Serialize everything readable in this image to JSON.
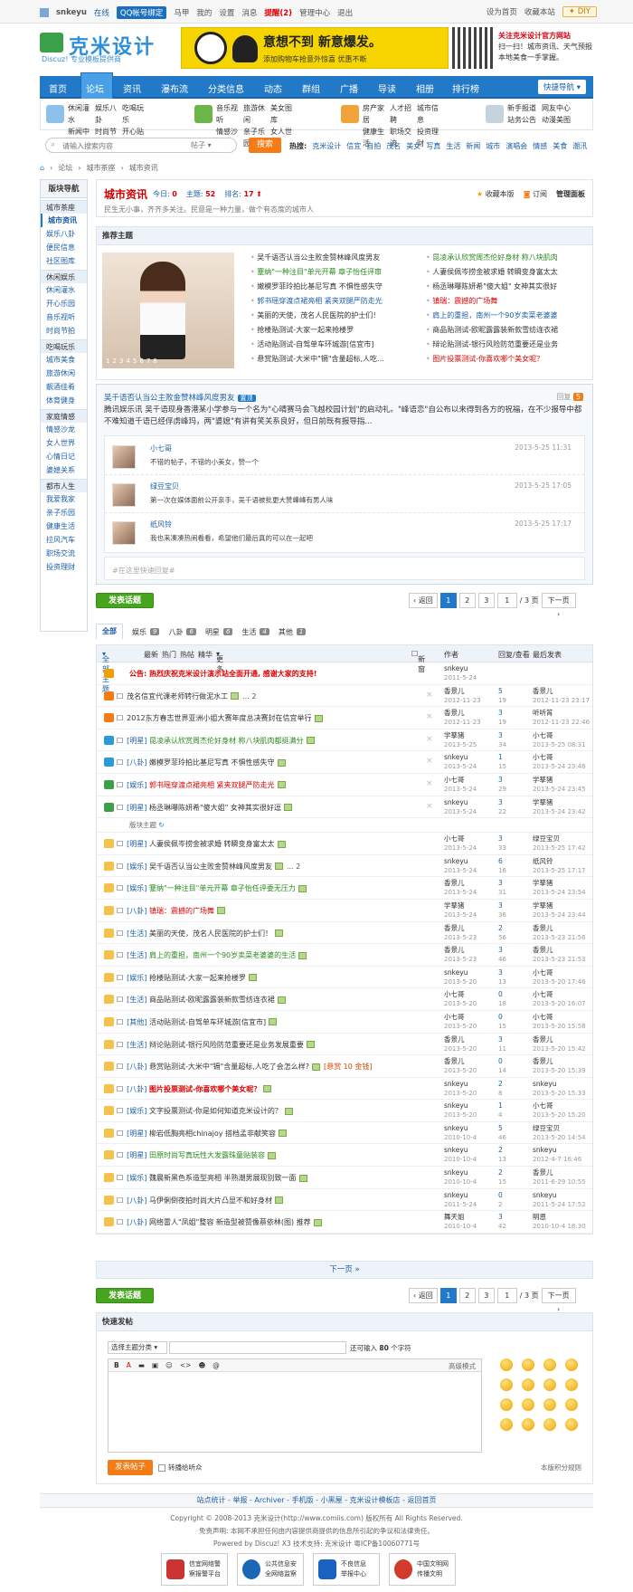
{
  "topbar": {
    "user": "snkeyu",
    "status": "在线",
    "qq": "QQ帐号绑定",
    "horse": "马甲",
    "my": "我的",
    "settings": "设置",
    "msg": "消息",
    "remind": "提醒(2)",
    "admin": "管理中心",
    "logout": "退出",
    "home": "设为首页",
    "fav": "收藏本站",
    "diy": "DIY"
  },
  "logo": {
    "name": "克米设计",
    "sub": "Discuz! 专业模板提供商"
  },
  "banner": {
    "line1": "意想不到",
    "line2": "新意爆发。",
    "line3": "添加购物车抢意外惊喜 优惠不断"
  },
  "qr": {
    "title": "关注克米设计官方网站",
    "l2": "扫一扫！城市资讯、天气预报",
    "l3": "本地美食一手掌握。"
  },
  "nav": {
    "items": [
      "首页",
      "论坛",
      "资讯",
      "瀑布流",
      "分类信息",
      "动态",
      "群组",
      "广播",
      "导读",
      "相册",
      "排行榜"
    ],
    "quick": "快捷导航"
  },
  "subnav": [
    [
      "休闲灌水",
      "娱乐八卦",
      "吃喝玩乐",
      "新闻中心",
      "时尚节拍",
      "开心贴图"
    ],
    [
      "音乐视听",
      "旅游休闲",
      "美女图库",
      "情感沙龙",
      "亲子乐园",
      "女人世界"
    ],
    [
      "房产家居",
      "人才招聘",
      "城市信息",
      "健康生活",
      "职场交流",
      "投资理财"
    ],
    [
      "新手报道",
      "网友中心",
      "站务公告",
      "动漫美图"
    ]
  ],
  "search": {
    "placeholder": "请输入搜索内容",
    "type": "帖子",
    "btn": "搜索",
    "hot_label": "热搜:",
    "hot": [
      "克米设计",
      "信宜",
      "自拍",
      "茂名",
      "美女",
      "写真",
      "生活",
      "新闻",
      "城市",
      "演唱会",
      "情感",
      "美食",
      "潮汛"
    ]
  },
  "crumb": [
    "论坛",
    "城市茶座",
    "城市资讯"
  ],
  "side": {
    "title": "版块导航",
    "groups": [
      {
        "name": "城市茶座",
        "items": [
          "城市资讯",
          "娱乐八卦",
          "便民信息",
          "社区图库"
        ]
      },
      {
        "name": "休闲娱乐",
        "items": [
          "休闲灌水",
          "开心乐园",
          "音乐视听",
          "时尚节拍"
        ]
      },
      {
        "name": "吃喝玩乐",
        "items": [
          "城市美食",
          "旅游休闲",
          "靓酒佳肴",
          "体育健身"
        ]
      },
      {
        "name": "家庭情感",
        "items": [
          "情感沙龙",
          "女人世界",
          "心情日记",
          "婆媳关系"
        ]
      },
      {
        "name": "都市人生",
        "items": [
          "我爱我家",
          "亲子乐园",
          "健康生活",
          "拉风汽车",
          "职场交流",
          "投资理财"
        ]
      }
    ]
  },
  "forum": {
    "title": "城市资讯",
    "today_label": "今日:",
    "today": "0",
    "topics_label": "主题:",
    "topics": "52",
    "rank_label": "排名:",
    "rank": "17",
    "desc": "民生无小事，齐齐多关注。民意是一种力量，做个有态度的城市人",
    "fav": "收藏本版",
    "sub": "订阅",
    "mgr": "管理面板"
  },
  "rec": {
    "title": "推荐主题",
    "dots": [
      "1",
      "2",
      "3",
      "4",
      "5",
      "6",
      "7",
      "8"
    ],
    "col1": [
      "吴千语否认当公主败金赞林峰风度男友",
      "蹇纳\"一种注目\"单元开幕 章子怡任评审",
      "嫩模罗菲玲拍比基尼写真 不惧性感失守",
      "郭书瑶穿渡点裙亮相 紧夹双腿严防走光",
      "美丽的天使，茂名人民医院的护士们！",
      "抢楼贴测试-大家一起来抢楼罗",
      "活动贴测试-自驾单车环城游[信宜市]",
      "悬赏贴测试-大米中\"镉\"含量超标,人吃..."
    ],
    "col2": [
      "昆凌承认欣赏周杰伦好身材 称八块肌肉",
      "人妻侯佩岑捞金被求婚 转瞬变身富太太",
      "杨丞琳曝陈妍希\"傻大姐\" 女神其实很好",
      "镇瑞：震撼的广场舞",
      "肩上的重担，南州一个90岁卖菜老婆婆",
      "商品贴测试-欧昵露露装新款雪纺连衣裙",
      "辩论贴测试-银行风险防范重要还是业务",
      "图片投票测试-你喜欢哪个美女呢？"
    ]
  },
  "hot": {
    "title": "吴千语否认当公主败金赞林峰风度男友",
    "tag": "置顶",
    "reply_label": "回复",
    "reply": "5",
    "summary": "腾讯娱乐讯 吴千语现身香港某小学参与一个名为\"心晴赛马会飞越校园计划\"的启动礼。\"峰语恋\"自公布以来得到各方的祝福，在不少报导中都不难知道千语已经俘虏峰玛，两\"婆媳\"有讲有笑关系良好，但日前既有报导指...",
    "comments": [
      {
        "name": "小七哥",
        "text": "不错的帖子，不错的小美女，赞一个",
        "time": "2013-5-25 11:31"
      },
      {
        "name": "绿豆宝贝",
        "text": "第一次在媒体面前公开亲手，吴千语被批更大赞峰峰有男人味",
        "time": "2013-5-25 17:05"
      },
      {
        "name": "纸风铃",
        "text": "我也来凑凑热闹看看，希望他们最后真的可以在一起吧",
        "time": "2013-5-25 17:17"
      }
    ],
    "quick_reply": "#在这里快速回复#"
  },
  "post_btn": "发表话题",
  "pager": {
    "prev": "返回",
    "pages": [
      "1",
      "2",
      "3"
    ],
    "input": "1",
    "total": "/ 3 页",
    "next": "下一页"
  },
  "tabs": [
    {
      "label": "全部",
      "count": ""
    },
    {
      "label": "娱乐",
      "count": "9"
    },
    {
      "label": "八卦",
      "count": "6"
    },
    {
      "label": "明星",
      "count": "6"
    },
    {
      "label": "生活",
      "count": "4"
    },
    {
      "label": "其他",
      "count": "1"
    }
  ],
  "thead": {
    "all": "全部主题",
    "links": [
      "最新",
      "热门",
      "热帖",
      "精华",
      "更多"
    ],
    "newwin": "新窗",
    "author": "作者",
    "reply": "回复/查看",
    "last": "最后发表"
  },
  "sep_label": "版块主题",
  "rows_top": [
    {
      "t": "公告: 热烈庆祝克米设计演示站全面开通, 感谢大家的支持!",
      "ty": "",
      "cls": "hl",
      "a": "snkeyu",
      "d": "2011-5-24",
      "r": "",
      "v": "",
      "l": "",
      "ld": "",
      "icon": "ann"
    },
    {
      "t": "茂名信宜代课老师转行做泥水工",
      "ty": "",
      "cls": "",
      "a": "香景儿",
      "d": "2012-11-23",
      "r": "5",
      "v": "19",
      "l": "香景儿",
      "ld": "2012-11-23 23:17",
      "icon": "top3",
      "extra": "... 2"
    },
    {
      "t": "2012东方春志世界亚洲小姐大赛年度总决赛封在信宜举行",
      "ty": "",
      "cls": "",
      "a": "香景儿",
      "d": "2012-11-23",
      "r": "3",
      "v": "19",
      "l": "听听筲",
      "ld": "2012-11-23 22:46",
      "icon": "top3"
    },
    {
      "t": "昆凌承认欣赏周杰伦好身材 称八块肌肉都挺满分",
      "ty": "[明星]",
      "cls": "gn",
      "a": "学孳猪",
      "d": "2013-5-25",
      "r": "3",
      "v": "34",
      "l": "小七哥",
      "ld": "2013-5-25 08:31",
      "icon": "top2"
    },
    {
      "t": "嫩模罗菲玲拍比基尼写真 不惧性感失守",
      "ty": "[八卦]",
      "cls": "",
      "a": "snkeyu",
      "d": "2013-5-24",
      "r": "1",
      "v": "15",
      "l": "小七哥",
      "ld": "2013-5-24 23:46",
      "icon": "top2"
    },
    {
      "t": "郭书瑶穿渡点裙亮相 紧夹双腿严防走光",
      "ty": "[娱乐]",
      "cls": "hl2",
      "a": "小七哥",
      "d": "2013-5-24",
      "r": "3",
      "v": "29",
      "l": "学孳猪",
      "ld": "2013-5-24 23:45",
      "icon": "top1"
    },
    {
      "t": "杨丞琳曝陈妍希\"傻大姐\" 女神其实很好逗",
      "ty": "[明星]",
      "cls": "",
      "a": "snkeyu",
      "d": "2013-5-24",
      "r": "3",
      "v": "22",
      "l": "学孳猪",
      "ld": "2013-5-24 23:42",
      "icon": "top1"
    }
  ],
  "rows": [
    {
      "t": "人妻侯佩岑捞金被求婚 转瞬变身富太太",
      "ty": "[明星]",
      "cls": "",
      "a": "小七哥",
      "d": "2013-5-24",
      "r": "3",
      "v": "33",
      "l": "绿豆宝贝",
      "ld": "2013-5-25 17:42"
    },
    {
      "t": "吴千语否认当公主败金赞林峰风度男友",
      "ty": "[娱乐]",
      "cls": "",
      "a": "snkeyu",
      "d": "2013-5-24",
      "r": "6",
      "v": "16",
      "l": "纸风铃",
      "ld": "2013-5-25 17:17",
      "extra": "... 2"
    },
    {
      "t": "蹇纳\"一种注目\"单元开幕 章子怡任评委无压力",
      "ty": "[娱乐]",
      "cls": "gn",
      "a": "香景儿",
      "d": "2013-5-24",
      "r": "3",
      "v": "31",
      "l": "学孳猪",
      "ld": "2013-5-24 23:54"
    },
    {
      "t": "镇瑞：震撼的广场舞",
      "ty": "[八卦]",
      "cls": "hl2",
      "a": "学孳猪",
      "d": "2013-5-24",
      "r": "3",
      "v": "36",
      "l": "学孳猪",
      "ld": "2013-5-24 23:44"
    },
    {
      "t": "美丽的天使，茂名人民医院的护士们！",
      "ty": "[生活]",
      "cls": "",
      "a": "香景儿",
      "d": "2013-5-23",
      "r": "2",
      "v": "56",
      "l": "香景儿",
      "ld": "2013-5-23 21:56"
    },
    {
      "t": "肩上的重担，南州一个90岁卖菜老婆婆的生活",
      "ty": "[生活]",
      "cls": "gn",
      "a": "香景儿",
      "d": "2013-5-23",
      "r": "3",
      "v": "46",
      "l": "香景儿",
      "ld": "2013-5-23 21:53"
    },
    {
      "t": "抢楼贴测试-大家一起来抢楼罗",
      "ty": "[娱乐]",
      "cls": "",
      "a": "snkeyu",
      "d": "2013-5-20",
      "r": "3",
      "v": "13",
      "l": "小七哥",
      "ld": "2013-5-20 17:46"
    },
    {
      "t": "商品贴测试-欧昵露露装新款雪纺连衣裙",
      "ty": "[生活]",
      "cls": "",
      "a": "小七哥",
      "d": "2013-5-20",
      "r": "0",
      "v": "18",
      "l": "小七哥",
      "ld": "2013-5-20 16:07"
    },
    {
      "t": "活动贴测试-自驾单车环城游[信宜市]",
      "ty": "[其他]",
      "cls": "",
      "a": "小七哥",
      "d": "2013-5-20",
      "r": "0",
      "v": "15",
      "l": "小七哥",
      "ld": "2013-5-20 15:58"
    },
    {
      "t": "辩论贴测试-银行风险防范重要还是业务发展重要",
      "ty": "[生活]",
      "cls": "",
      "a": "香景儿",
      "d": "2013-5-20",
      "r": "3",
      "v": "11",
      "l": "香景儿",
      "ld": "2013-5-20 15:42"
    },
    {
      "t": "悬赏贴测试-大米中\"镉\"含量超标,人吃了会怎么样?",
      "ty": "[八卦]",
      "cls": "",
      "a": "香景儿",
      "d": "2013-5-20",
      "r": "0",
      "v": "14",
      "l": "香景儿",
      "ld": "2013-5-20 15:39",
      "reward": "[悬赏 10 金钱]"
    },
    {
      "t": "图片投票测试-你喜欢哪个美女呢？",
      "ty": "[八卦]",
      "cls": "hl",
      "a": "snkeyu",
      "d": "2013-5-20",
      "r": "2",
      "v": "8",
      "l": "snkeyu",
      "ld": "2013-5-20 15:33"
    },
    {
      "t": "文字投票测试-你是如何知道克米设计的？",
      "ty": "[娱乐]",
      "cls": "",
      "a": "snkeyu",
      "d": "2013-5-20",
      "r": "1",
      "v": "4",
      "l": "小七哥",
      "ld": "2013-5-20 15:20"
    },
    {
      "t": "柳岩低胸亮相chinajoy 搭档孟非献笑容",
      "ty": "[明星]",
      "cls": "",
      "a": "snkeyu",
      "d": "2010-10-4",
      "r": "5",
      "v": "46",
      "l": "绿豆宝贝",
      "ld": "2013-5-20 14:54"
    },
    {
      "t": "田原时尚写真玩性大发露珠童贴装容",
      "ty": "[明星]",
      "cls": "gn",
      "a": "snkeyu",
      "d": "2010-10-4",
      "r": "2",
      "v": "13",
      "l": "snkeyu",
      "ld": "2012-4-7 16:46"
    },
    {
      "t": "魏晨新黑色系造型亮相 半熟潮男展现别致一面",
      "ty": "[娱乐]",
      "cls": "",
      "a": "snkeyu",
      "d": "2010-10-4",
      "r": "2",
      "v": "15",
      "l": "香景儿",
      "ld": "2011-6-29 10:55"
    },
    {
      "t": "马伊俐倒夜拍时尚大片凸显不和好身材",
      "ty": "[八卦]",
      "cls": "",
      "a": "snkeyu",
      "d": "2011-5-24",
      "r": "0",
      "v": "2",
      "l": "snkeyu",
      "ld": "2011-5-24 17:52"
    },
    {
      "t": "网络雷人\"凤姐\"整容 新造型被赞像蔡依林(图) 推荐",
      "ty": "[八卦]",
      "cls": "",
      "a": "舞天姐",
      "d": "2010-10-4",
      "r": "3",
      "v": "42",
      "l": "明恩",
      "ld": "2010-10-4 18:30"
    }
  ],
  "more": "下一页 »",
  "quickpost": {
    "title": "快速发帖",
    "type": "选择主题分类",
    "limit_pre": "还可输入",
    "limit": "80",
    "limit_post": "个字符",
    "mode": "高级模式",
    "btn": "发表帖子",
    "check": "转播给听众",
    "rule": "本版积分规则",
    "tools": [
      "B",
      "A",
      "▬",
      "▣",
      "☺",
      "<>",
      "☻",
      "@"
    ]
  },
  "footer": {
    "links": "站点统计 - 举报 - Archiver - 手机版 - 小黑屋 - 克米设计模板店 - 返回首页",
    "copy": "Copyright © 2008-2013 克米设计(http://www.comiis.com) 版权所有 All Rights Reserved.",
    "disc": "免责声明: 本网不承担任何由内容提供商提供的信息所引起的争议和法律责任。",
    "power": "Powered by Discuz! X3  技术支持: 克米设计  粤ICP备10060771号",
    "badges": [
      [
        "信宜网络警",
        "察报警平台"
      ],
      [
        "公共信息安",
        "全网络监察"
      ],
      [
        "不良信息",
        "举报中心"
      ],
      [
        "中国文明网",
        "传播文明"
      ]
    ]
  },
  "colors": {
    "nav": "#2179c8",
    "accent": "#f47b16",
    "green": "#47a41f",
    "red": "#cc0000"
  }
}
